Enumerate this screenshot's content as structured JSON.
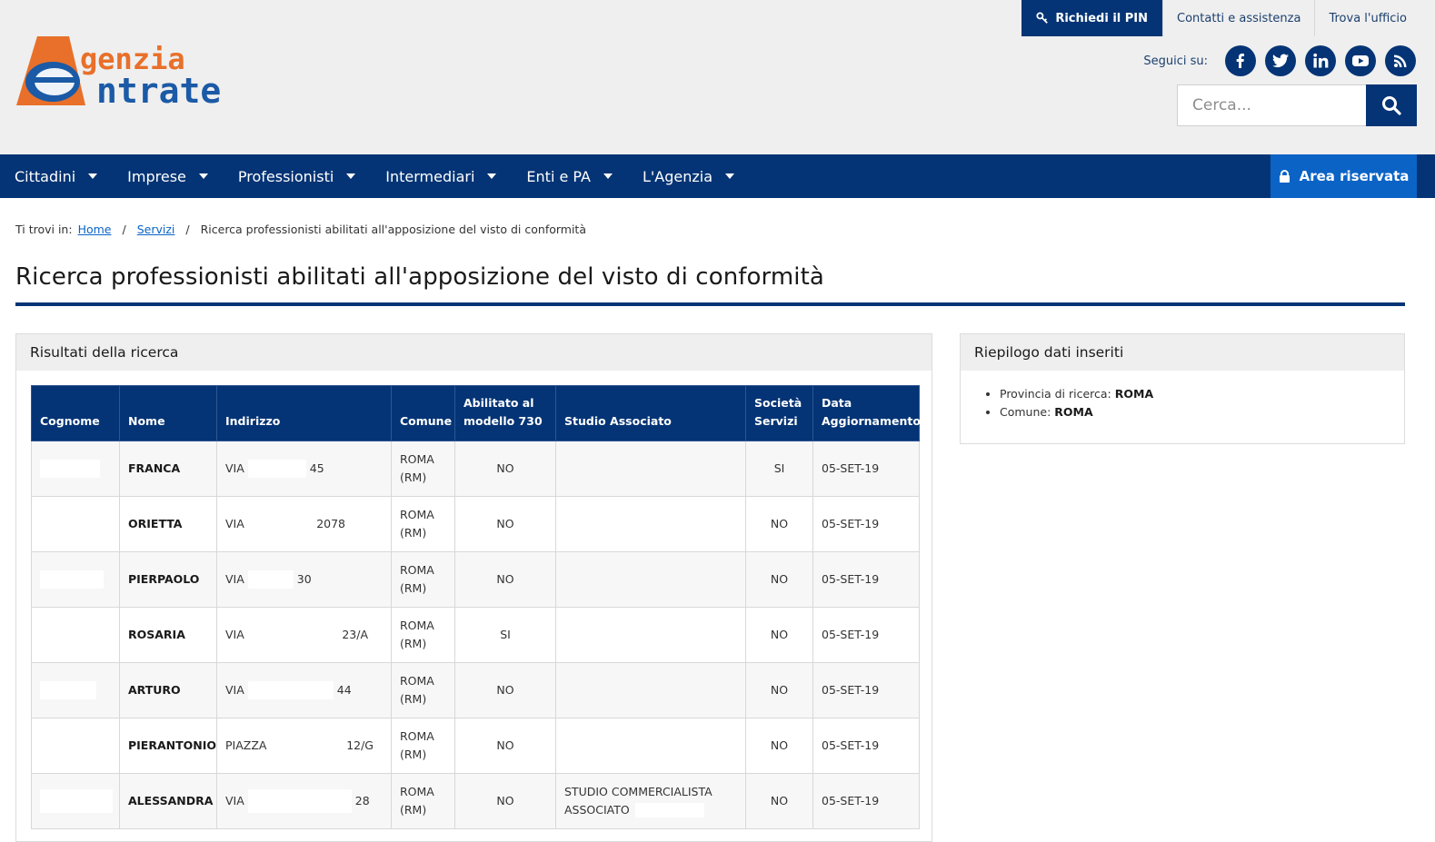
{
  "header": {
    "logo_text_top": "genzia",
    "logo_text_bottom": "ntrate",
    "pin_label": "Richiedi il PIN",
    "contacts_label": "Contatti e assistenza",
    "office_label": "Trova l'ufficio",
    "social_label": "Seguici su:",
    "social_icons": [
      "facebook-icon",
      "twitter-icon",
      "linkedin-icon",
      "youtube-icon",
      "rss-icon"
    ],
    "search_placeholder": "Cerca..."
  },
  "nav": {
    "items": [
      "Cittadini",
      "Imprese",
      "Professionisti",
      "Intermediari",
      "Enti e PA",
      "L'Agenzia"
    ],
    "area_label": "Area riservata"
  },
  "breadcrumb": {
    "prefix": "Ti trovi in:",
    "home": "Home",
    "servizi": "Servizi",
    "current": "Ricerca professionisti abilitati all'apposizione del visto di conformità"
  },
  "page_title": "Ricerca professionisti abilitati all'apposizione del visto di conformità",
  "results": {
    "title": "Risultati della ricerca",
    "columns": [
      "Cognome",
      "Nome",
      "Indirizzo",
      "Comune",
      "Abilitato al modello 730",
      "Studio Associato",
      "Società Servizi",
      "Data Aggiornamento"
    ],
    "rows": [
      {
        "nome": "FRANCA",
        "via": "VIA",
        "num": "45",
        "comune1": "ROMA",
        "comune2": "(RM)",
        "m730": "NO",
        "studio1": "",
        "studio2": "",
        "societa": "SI",
        "data": "05-SET-19"
      },
      {
        "nome": "ORIETTA",
        "via": "VIA",
        "num": "2078",
        "comune1": "ROMA",
        "comune2": "(RM)",
        "m730": "NO",
        "studio1": "",
        "studio2": "",
        "societa": "NO",
        "data": "05-SET-19"
      },
      {
        "nome": "PIERPAOLO",
        "via": "VIA",
        "num": "30",
        "comune1": "ROMA",
        "comune2": "(RM)",
        "m730": "NO",
        "studio1": "",
        "studio2": "",
        "societa": "NO",
        "data": "05-SET-19"
      },
      {
        "nome": "ROSARIA",
        "via": "VIA",
        "num": "23/A",
        "comune1": "ROMA",
        "comune2": "(RM)",
        "m730": "SI",
        "studio1": "",
        "studio2": "",
        "societa": "NO",
        "data": "05-SET-19"
      },
      {
        "nome": "ARTURO",
        "via": "VIA",
        "num": "44",
        "comune1": "ROMA",
        "comune2": "(RM)",
        "m730": "NO",
        "studio1": "",
        "studio2": "",
        "societa": "NO",
        "data": "05-SET-19"
      },
      {
        "nome": "PIERANTONIO",
        "via": "PIAZZA",
        "num": "12/G",
        "comune1": "ROMA",
        "comune2": "(RM)",
        "m730": "NO",
        "studio1": "",
        "studio2": "",
        "societa": "NO",
        "data": "05-SET-19"
      },
      {
        "nome": "ALESSANDRA",
        "via": "VIA",
        "num": "28",
        "comune1": "ROMA",
        "comune2": "(RM)",
        "m730": "NO",
        "studio1": "STUDIO COMMERCIALISTA",
        "studio2": "ASSOCIATO",
        "societa": "NO",
        "data": "05-SET-19"
      }
    ]
  },
  "summary": {
    "title": "Riepilogo dati inseriti",
    "provincia_label": "Provincia di ricerca:",
    "provincia_value": "ROMA",
    "comune_label": "Comune:",
    "comune_value": "ROMA"
  },
  "colors": {
    "primary": "#043475",
    "accent_blue": "#0b63c6",
    "logo_orange": "#e8702a",
    "header_bg": "#efefef"
  }
}
